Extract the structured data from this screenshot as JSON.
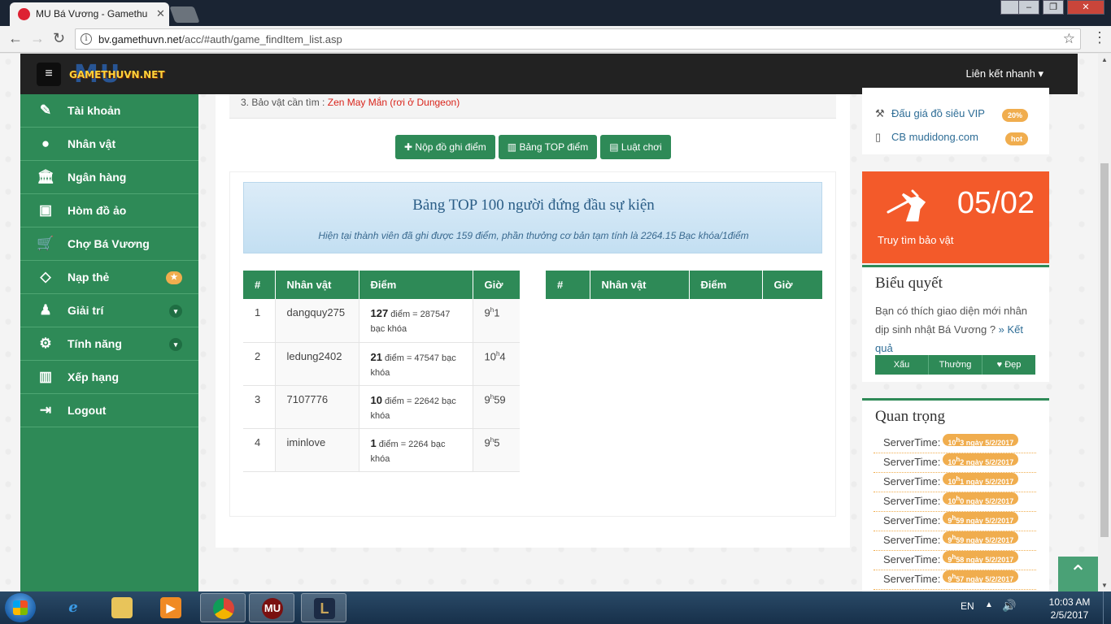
{
  "browser": {
    "tab_title": "MU Bá Vương - Gamethu",
    "url_host": "bv.gamethuvn.net",
    "url_path": "/acc/#auth/game_findItem_list.asp"
  },
  "navbar": {
    "logo_bg": "MU",
    "logo_text": "GAMETHUVN.NET",
    "quicklink": "Liên kết nhanh"
  },
  "sidebar": {
    "items": [
      {
        "label": "Tài khoản",
        "icon": "edit-icon"
      },
      {
        "label": "Nhân vật",
        "icon": "user-icon"
      },
      {
        "label": "Ngân hàng",
        "icon": "bank-icon"
      },
      {
        "label": "Hòm đồ ảo",
        "icon": "briefcase-icon"
      },
      {
        "label": "Chợ Bá Vương",
        "icon": "cart-icon"
      },
      {
        "label": "Nạp thẻ",
        "icon": "diamond-icon"
      },
      {
        "label": "Giải trí",
        "icon": "android-icon"
      },
      {
        "label": "Tính năng",
        "icon": "gears-icon"
      },
      {
        "label": "Xếp hạng",
        "icon": "bar-chart-icon"
      },
      {
        "label": "Logout",
        "icon": "sign-out-icon"
      }
    ]
  },
  "main": {
    "notice_prefix": "3. Bảo vật cần tìm :",
    "notice_item": "Zen May Mắn (rơi ở Dungeon)",
    "buttons": {
      "submit": "Nộp đồ ghi điểm",
      "top": "Bảng TOP điểm",
      "rules": "Luật chơi"
    },
    "event_title": "Bảng TOP 100 người đứng đầu sự kiện",
    "event_subtitle": "Hiện tại thành viên đã ghi được 159 điểm, phần thưởng cơ bản tạm tính là 2264.15 Bạc khóa/1điểm",
    "table_headers": [
      "#",
      "Nhân vật",
      "Điểm",
      "Giờ"
    ],
    "rows": [
      {
        "rank": "1",
        "name": "dangquy275",
        "points": "127",
        "points_unit": "điểm",
        "reward": "= 287547 bạc khóa",
        "hour": "9",
        "minute": "1"
      },
      {
        "rank": "2",
        "name": "ledung2402",
        "points": "21",
        "points_unit": "điểm",
        "reward": "= 47547 bạc khóa",
        "hour": "10",
        "minute": "4"
      },
      {
        "rank": "3",
        "name": "7107776",
        "points": "10",
        "points_unit": "điểm",
        "reward": "= 22642 bạc khóa",
        "hour": "9",
        "minute": "59"
      },
      {
        "rank": "4",
        "name": "iminlove",
        "points": "1",
        "points_unit": "điểm",
        "reward": "= 2264 bạc khóa",
        "hour": "9",
        "minute": "5"
      }
    ],
    "time_sep": "h"
  },
  "right": {
    "links": [
      {
        "label": "Đấu giá đồ siêu VIP",
        "badge": "20%",
        "icon": "gavel-icon"
      },
      {
        "label": "CB mudidong.com",
        "badge": "hot",
        "icon": "mobile-icon"
      }
    ],
    "countdown": {
      "value": "05/02",
      "label": "Truy tìm bảo vật"
    },
    "poll": {
      "title": "Biểu quyết",
      "question": "Bạn có thích giao diện mới nhân dịp sinh nhật Bá Vương ?",
      "result_link": "» Kết quả",
      "options": [
        "Xấu",
        "Thường",
        "Đẹp"
      ]
    },
    "important": {
      "title": "Quan trọng",
      "label": "ServerTime:",
      "entries": [
        {
          "h": "10",
          "m": "3",
          "date": "ngày 5/2/2017"
        },
        {
          "h": "10",
          "m": "2",
          "date": "ngày 5/2/2017"
        },
        {
          "h": "10",
          "m": "1",
          "date": "ngày 5/2/2017"
        },
        {
          "h": "10",
          "m": "0",
          "date": "ngày 5/2/2017"
        },
        {
          "h": "9",
          "m": "59",
          "date": "ngày 5/2/2017"
        },
        {
          "h": "9",
          "m": "59",
          "date": "ngày 5/2/2017"
        },
        {
          "h": "9",
          "m": "58",
          "date": "ngày 5/2/2017"
        },
        {
          "h": "9",
          "m": "57",
          "date": "ngày 5/2/2017"
        }
      ]
    }
  },
  "taskbar": {
    "lang": "EN",
    "time": "10:03 AM",
    "date": "2/5/2017"
  },
  "colors": {
    "green": "#2e8a57",
    "orange": "#f35a2a",
    "badge": "#f0ad4e"
  }
}
